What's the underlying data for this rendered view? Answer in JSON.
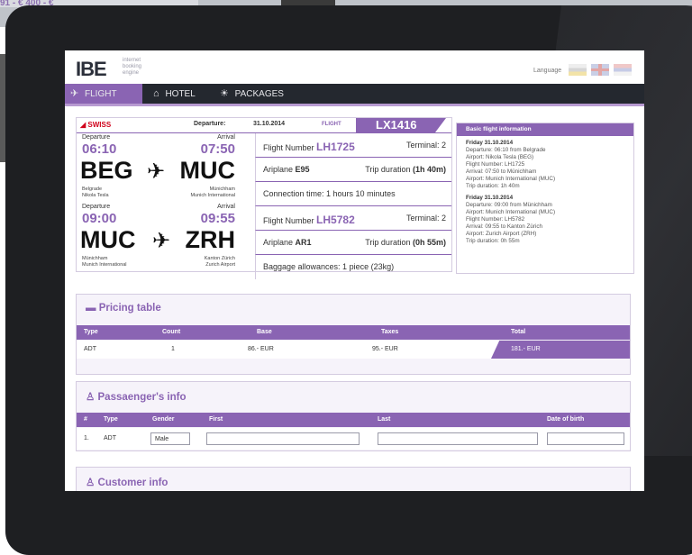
{
  "background": {
    "strip_text": "91 - €   400 - €"
  },
  "header": {
    "logo_text": "IBE",
    "logo_sub": "internet booking engine",
    "language_label": "Language",
    "flags": [
      "de-flag",
      "uk-flag",
      "rs-flag"
    ]
  },
  "nav": [
    {
      "label": "FLIGHT",
      "icon": "✈",
      "active": true
    },
    {
      "label": "HOTEL",
      "icon": "⌂",
      "active": false
    },
    {
      "label": "PACKAGES",
      "icon": "☀",
      "active": false
    }
  ],
  "flight": {
    "airline": "SWISS",
    "departure_label": "Departure:",
    "departure_date": "31.10.2014",
    "flight_label": "FLIGHT",
    "flight_code": "LX1416",
    "segments": [
      {
        "dep_label": "Departure",
        "arr_label": "Arrival",
        "dep_time": "06:10",
        "arr_time": "07:50",
        "from": "BEG",
        "to": "MUC",
        "from_city": "Belgrade",
        "from_airport": "Nikola Tesla",
        "to_city": "Münichham",
        "to_airport": "Munich International"
      },
      {
        "dep_label": "Departure",
        "arr_label": "Arrival",
        "dep_time": "09:00",
        "arr_time": "09:55",
        "from": "MUC",
        "to": "ZRH",
        "from_city": "Münichham",
        "from_airport": "Munich International",
        "to_city": "Kanton Zürich",
        "to_airport": "Zurich Airport"
      }
    ],
    "rows": {
      "fn1_label": "Flight Number",
      "fn1": "LH1725",
      "term1": "Terminal: 2",
      "plane1_label": "Ariplane",
      "plane1": "E95",
      "dur1_label": "Trip duration",
      "dur1": "(1h 40m)",
      "connection": "Connection time: 1 hours 10 minutes",
      "fn2_label": "Flight Number",
      "fn2": "LH5782",
      "term2": "Terminal: 2",
      "plane2_label": "Ariplane",
      "plane2": "AR1",
      "dur2_label": "Trip duration",
      "dur2": "(0h 55m)",
      "baggage": "Baggage allowances: 1 piece (23kg)"
    }
  },
  "info": {
    "title": "Basic flight information",
    "seg1": {
      "date": "Friday 31.10.2014",
      "departure": "Departure: 06:10 from Belgrade",
      "airport": "Airport: Nikola Tesla (BEG)",
      "flight_number": "Flight Number: LH1725",
      "arrival": "Arrival: 07:50  to Münichham",
      "arr_airport": "Airport: Munich International (MUC)",
      "duration": "Trip duration: 1h 40m"
    },
    "seg2": {
      "date": "Friday 31.10.2014",
      "departure": "Departure: 09:00 from Münichham",
      "airport": "Airport: Munich International (MUC)",
      "flight_number": "Flight Number: LH5782",
      "arrival": "Arrival: 09:55  to Kanton Zürich",
      "arr_airport": "Airport: Zurich Airport (ZRH)",
      "duration": "Trip duration: 0h 55m"
    }
  },
  "pricing": {
    "title": "Pricing table",
    "headers": [
      "Type",
      "Count",
      "Base",
      "Taxes",
      "Total"
    ],
    "row": [
      "ADT",
      "1",
      "86.- EUR",
      "95.- EUR",
      "181.- EUR"
    ]
  },
  "passengers": {
    "title": "Passaenger's info",
    "headers": [
      "#",
      "Type",
      "Gender",
      "First",
      "Last",
      "Date of birth"
    ],
    "row": {
      "num": "1.",
      "type": "ADT",
      "gender": "Male",
      "first": "",
      "last": "",
      "dob": ""
    }
  },
  "customer": {
    "title": "Customer info"
  },
  "colors": {
    "accent": "#8a64b3",
    "nav_bg": "#24282f",
    "tablet": "#1e1f22"
  }
}
